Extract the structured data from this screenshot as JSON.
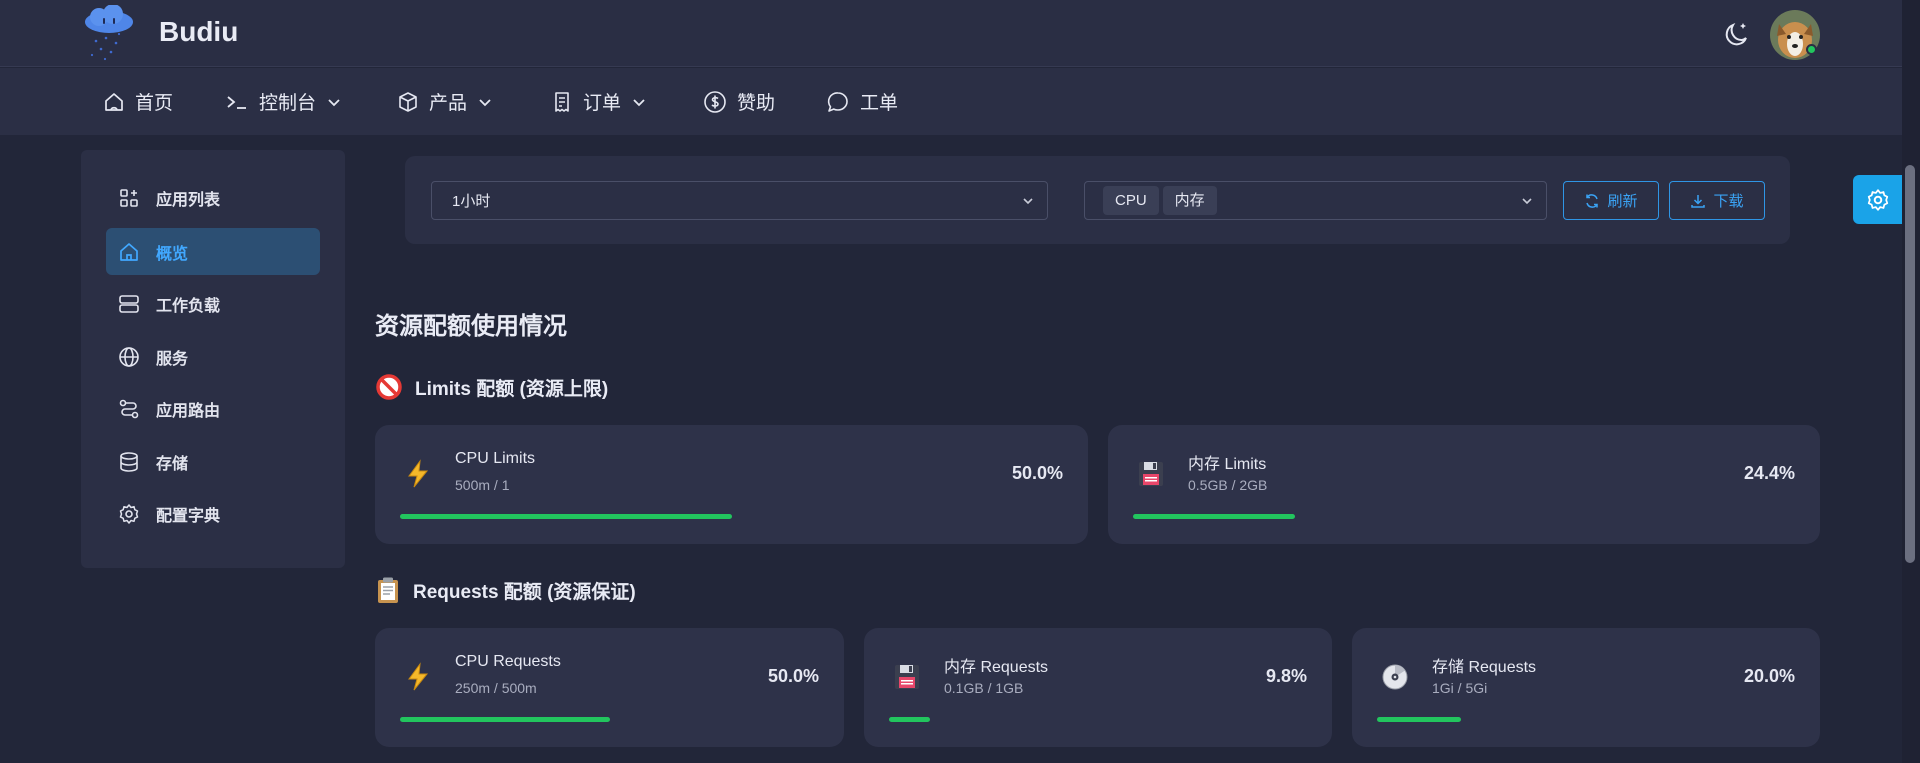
{
  "header": {
    "brand": "Budiu"
  },
  "nav": [
    {
      "label": "首页",
      "icon": "home-icon"
    },
    {
      "label": "控制台",
      "icon": "terminal-icon",
      "dropdown": true
    },
    {
      "label": "产品",
      "icon": "box-icon",
      "dropdown": true
    },
    {
      "label": "订单",
      "icon": "receipt-icon",
      "dropdown": true
    },
    {
      "label": "赞助",
      "icon": "dollar-icon"
    },
    {
      "label": "工单",
      "icon": "chat-icon"
    }
  ],
  "sidebar": {
    "items": [
      {
        "label": "应用列表",
        "icon": "grid-plus-icon"
      },
      {
        "label": "概览",
        "icon": "home-icon",
        "active": true
      },
      {
        "label": "工作负载",
        "icon": "server-icon"
      },
      {
        "label": "服务",
        "icon": "globe-icon"
      },
      {
        "label": "应用路由",
        "icon": "route-icon"
      },
      {
        "label": "存储",
        "icon": "database-icon"
      },
      {
        "label": "配置字典",
        "icon": "gear-icon"
      }
    ]
  },
  "filters": {
    "time_range": "1小时",
    "metrics_tags": [
      "CPU",
      "内存"
    ],
    "refresh_label": "刷新",
    "download_label": "下载"
  },
  "page": {
    "title": "资源配额使用情况",
    "limits_heading": "Limits 配额 (资源上限)",
    "requests_heading": "Requests 配额 (资源保证)"
  },
  "limits_cards": [
    {
      "title": "CPU Limits",
      "usage": "500m / 1",
      "percent_label": "50.0%",
      "fraction": 0.5,
      "icon": "lightning-icon"
    },
    {
      "title": "内存 Limits",
      "usage": "0.5GB / 2GB",
      "percent_label": "24.4%",
      "fraction": 0.244,
      "icon": "floppy-disk-icon"
    }
  ],
  "requests_cards": [
    {
      "title": "CPU Requests",
      "usage": "250m / 500m",
      "percent_label": "50.0%",
      "fraction": 0.5,
      "icon": "lightning-icon"
    },
    {
      "title": "内存 Requests",
      "usage": "0.1GB / 1GB",
      "percent_label": "9.8%",
      "fraction": 0.098,
      "icon": "floppy-disk-icon"
    },
    {
      "title": "存储 Requests",
      "usage": "1Gi / 5Gi",
      "percent_label": "20.0%",
      "fraction": 0.2,
      "icon": "disc-icon"
    }
  ],
  "colors": {
    "accent": "#3aa3f5",
    "progress": "#22c55e",
    "active_bg": "#2c4f73",
    "fab": "#1aa3e8"
  }
}
